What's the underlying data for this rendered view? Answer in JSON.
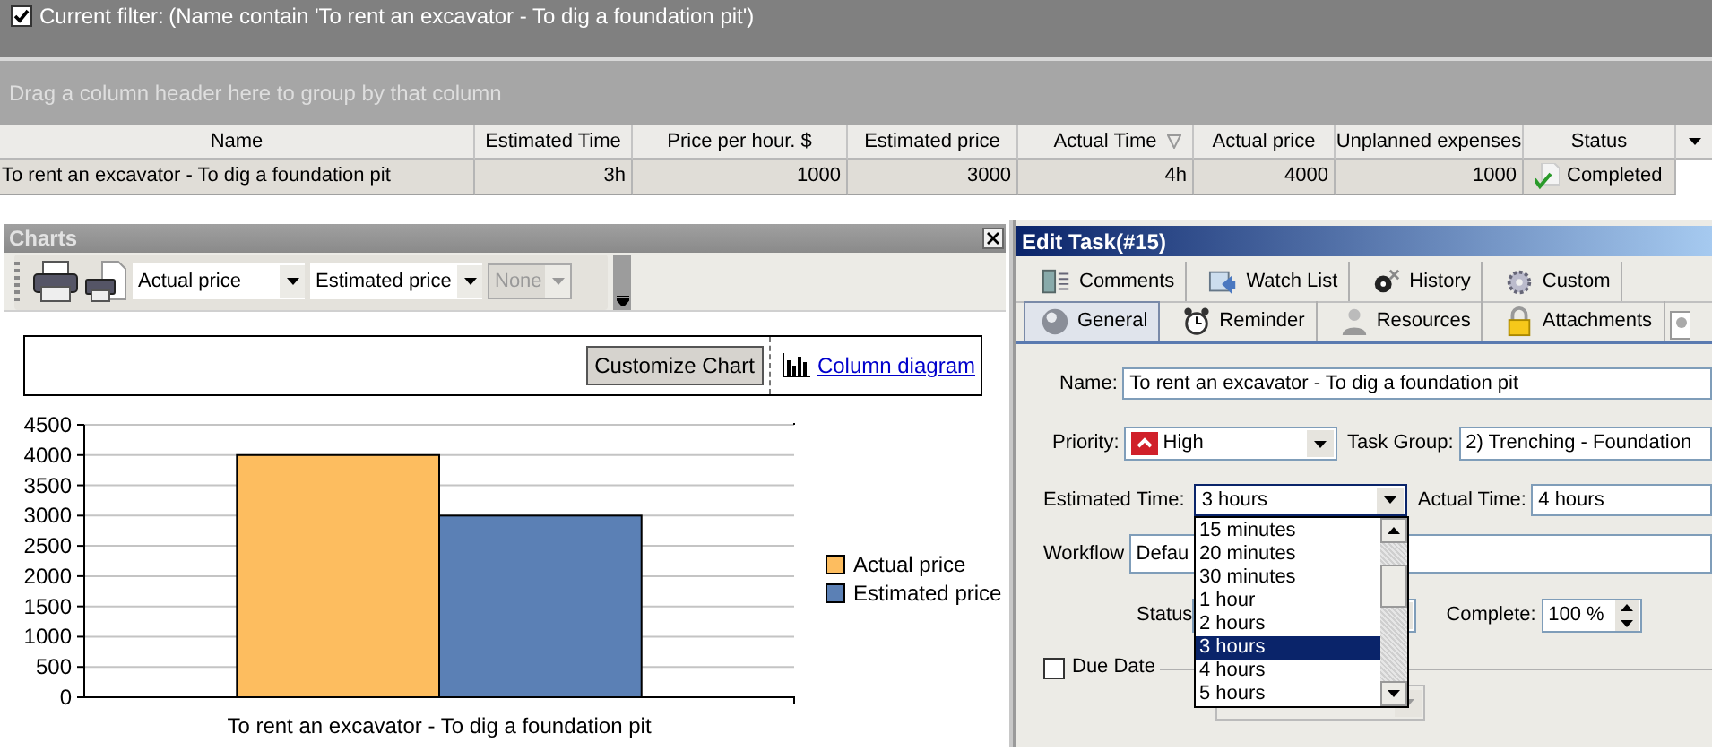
{
  "filter_bar": {
    "checked": true,
    "label": "Current filter:",
    "text": "(Name contain 'To rent an excavator - To dig a foundation pit')"
  },
  "group_panel": {
    "hint": "Drag a column header here to group by that column"
  },
  "grid": {
    "columns": [
      {
        "label": "Name",
        "sorted": false
      },
      {
        "label": "Estimated Time",
        "sorted": false
      },
      {
        "label": "Price per hour. $",
        "sorted": false
      },
      {
        "label": "Estimated price",
        "sorted": false
      },
      {
        "label": "Actual Time",
        "sorted": true
      },
      {
        "label": "Actual price",
        "sorted": false
      },
      {
        "label": "Unplanned expenses",
        "sorted": false
      },
      {
        "label": "Status",
        "sorted": false
      }
    ],
    "rows": [
      {
        "cells": [
          "To rent an excavator - To dig a foundation pit",
          "3h",
          "1000",
          "3000",
          "4h",
          "4000",
          "1000",
          "Completed"
        ]
      }
    ]
  },
  "charts_panel": {
    "title": "Charts",
    "selects": [
      {
        "value": "Actual price",
        "disabled": false
      },
      {
        "value": "Estimated price",
        "disabled": false
      },
      {
        "value": "None",
        "disabled": true
      }
    ],
    "customize_button": "Customize Chart",
    "chart_type_link": "Column diagram",
    "chart_data": {
      "type": "bar",
      "categories": [
        "To rent an excavator - To dig a foundation pit"
      ],
      "series": [
        {
          "name": "Actual price",
          "color": "#fdbd5f",
          "values": [
            4000
          ]
        },
        {
          "name": "Estimated price",
          "color": "#5b80b5",
          "values": [
            3000
          ]
        }
      ],
      "grid": true,
      "legend": true,
      "ylim": [
        0,
        4500
      ],
      "yticks": [
        {
          "value": 0,
          "label": "0"
        },
        {
          "value": 500,
          "label": "500"
        },
        {
          "value": 1000,
          "label": "1000"
        },
        {
          "value": 1500,
          "label": "1500"
        },
        {
          "value": 2000,
          "label": "2000"
        },
        {
          "value": 2500,
          "label": "2500"
        },
        {
          "value": 3000,
          "label": "3000"
        },
        {
          "value": 3500,
          "label": "3500"
        },
        {
          "value": 4000,
          "label": "4000"
        },
        {
          "value": 4500,
          "label": "4500"
        }
      ]
    }
  },
  "edit_task": {
    "title": "Edit Task(#15)",
    "tab_rows": [
      [
        {
          "label": "Comments",
          "selected": false
        },
        {
          "label": "Watch List",
          "selected": false
        },
        {
          "label": "History",
          "selected": false
        },
        {
          "label": "Custom",
          "selected": false
        }
      ],
      [
        {
          "label": "General",
          "selected": true
        },
        {
          "label": "Reminder",
          "selected": false
        },
        {
          "label": "Resources",
          "selected": false
        },
        {
          "label": "Attachments",
          "selected": false
        }
      ]
    ],
    "name": {
      "label": "Name:",
      "value": "To rent an excavator - To dig a foundation pit"
    },
    "priority": {
      "label": "Priority:",
      "value": "High"
    },
    "task_group": {
      "label": "Task Group:",
      "value": "2) Trenching - Foundation"
    },
    "estimated_time": {
      "label": "Estimated Time:",
      "value": "3 hours",
      "expanded": true
    },
    "actual_time": {
      "label": "Actual Time:",
      "value": "4 hours"
    },
    "workflow": {
      "label": "Workflow",
      "value": "Defau"
    },
    "status": {
      "label": "Status"
    },
    "complete": {
      "label": "Complete:",
      "value": "100 %"
    },
    "due_date": {
      "label": "Due Date",
      "checked": false
    },
    "time_options": [
      {
        "label": "15 minutes",
        "selected": false
      },
      {
        "label": "20 minutes",
        "selected": false
      },
      {
        "label": "30 minutes",
        "selected": false
      },
      {
        "label": "1 hour",
        "selected": false
      },
      {
        "label": "2 hours",
        "selected": false
      },
      {
        "label": "3 hours",
        "selected": true
      },
      {
        "label": "4 hours",
        "selected": false
      },
      {
        "label": "5 hours",
        "selected": false
      }
    ]
  }
}
